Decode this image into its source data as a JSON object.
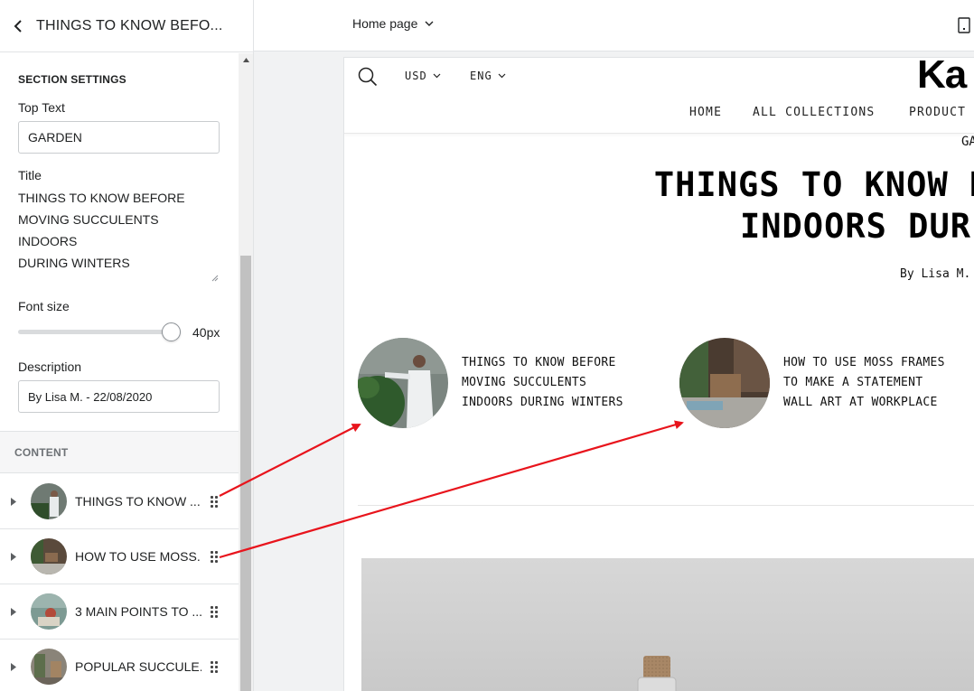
{
  "sidebar": {
    "title": "THINGS TO KNOW BEFO...",
    "section_heading": "SECTION SETTINGS",
    "top_text": {
      "label": "Top Text",
      "value": "GARDEN"
    },
    "title_field": {
      "label": "Title",
      "lines": [
        "THINGS TO KNOW BEFORE",
        "MOVING SUCCULENTS INDOORS",
        "DURING WINTERS"
      ]
    },
    "font_size": {
      "label": "Font size",
      "value": "40px",
      "fraction": 1.0
    },
    "description": {
      "label": "Description",
      "value": "By Lisa M. - 22/08/2020"
    },
    "content_heading": "CONTENT",
    "blocks": [
      {
        "label": "THINGS TO KNOW ..."
      },
      {
        "label": "HOW TO USE MOSS..."
      },
      {
        "label": "3 MAIN POINTS TO ..."
      },
      {
        "label": "POPULAR SUCCULE..."
      }
    ]
  },
  "topbar": {
    "page_select": "Home page"
  },
  "preview": {
    "currency": "USD",
    "language": "ENG",
    "logo": "Ka",
    "nav": [
      "HOME",
      "ALL COLLECTIONS",
      "PRODUCT"
    ],
    "top_text": "GA",
    "title_lines": [
      "THINGS TO KNOW BEFO",
      "INDOORS DUR"
    ],
    "byline": "By Lisa M.",
    "cards": [
      {
        "title": "THINGS TO KNOW BEFORE\nMOVING SUCCULENTS\nINDOORS DURING WINTERS"
      },
      {
        "title": "HOW TO USE MOSS FRAMES\nTO MAKE A STATEMENT\nWALL ART AT WORKPLACE"
      }
    ]
  },
  "colors": {
    "arrow": "#e8141c",
    "border": "#e1e3e5",
    "scroll_thumb": "#c1c1c1"
  },
  "icons": [
    "chevron-left-icon",
    "search-icon",
    "chevron-down-icon",
    "drag-handle-icon",
    "caret-right-icon",
    "device-icon"
  ]
}
